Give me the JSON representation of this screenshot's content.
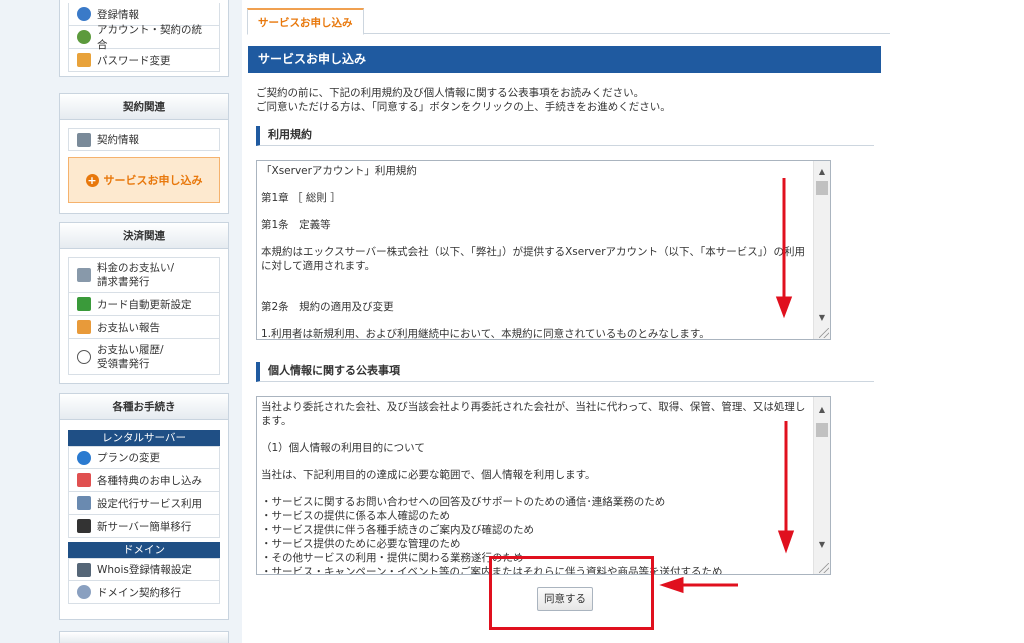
{
  "sidebar": {
    "top_items": [
      "登録情報",
      "アカウント・契約の統合",
      "パスワード変更"
    ],
    "contract": {
      "heading": "契約関連",
      "items": [
        "契約情報"
      ],
      "cta": "サービスお申し込み"
    },
    "payment": {
      "heading": "決済関連",
      "items": [
        "料金のお支払い/",
        "請求書発行",
        "カード自動更新設定",
        "お支払い報告",
        "お支払い履歴/",
        "受領書発行"
      ]
    },
    "procedures": {
      "heading": "各種お手続き",
      "rental_label": "レンタルサーバー",
      "rental_items": [
        "プランの変更",
        "各種特典のお申し込み",
        "設定代行サービス利用",
        "新サーバー簡単移行"
      ],
      "domain_label": "ドメイン",
      "domain_items": [
        "Whois登録情報設定",
        "ドメイン契約移行"
      ]
    }
  },
  "main": {
    "tab_label": "サービスお申し込み",
    "title": "サービスお申し込み",
    "intro_line1": "ご契約の前に、下記の利用規約及び個人情報に関する公表事項をお読みください。",
    "intro_line2": "ご同意いただける方は、「同意する」ボタンをクリックの上、手続きをお進めください。",
    "terms": {
      "heading": "利用規約",
      "lines": [
        "「Xserverアカウント」利用規約",
        "第1章 ［ 総則 ］",
        "第1条　定義等",
        "本規約はエックスサーバー株式会社（以下、「弊社」）が提供するXserverアカウント（以下、「本サービス」）の利用に対して適用されます。",
        "第2条　規約の適用及び変更",
        "1.利用者は新規利用、および利用継続中において、本規約に同意されているものとみなします。"
      ]
    },
    "privacy": {
      "heading": "個人情報に関する公表事項",
      "lines": [
        "当社より委託された会社、及び当該会社より再委託された会社が、当社に代わって、取得、保管、管理、又は処理します。",
        "（1）個人情報の利用目的について",
        "当社は、下記利用目的の達成に必要な範囲で、個人情報を利用します。",
        "・サービスに関するお問い合わせへの回答及びサポートのための通信･連絡業務のため",
        "・サービスの提供に係る本人確認のため",
        "・サービス提供に伴う各種手続きのご案内及び確認のため",
        "・サービス提供のために必要な管理のため",
        "・その他サービスの利用・提供に関わる業務遂行のため",
        "・サービス・キャンペーン・イベント等のご案内またはそれらに伴う資料や商品等を送付するため"
      ]
    },
    "agree_button": "同意する"
  },
  "colors": {
    "accent": "#1f5aa0",
    "orange": "#e8780c",
    "annotation_red": "#e0101e"
  },
  "icons": [
    "user-icon",
    "merge-icon",
    "lock-icon",
    "contract-icon",
    "plus-circle-icon",
    "bill-icon",
    "card-icon",
    "report-icon",
    "clock-icon",
    "change-icon",
    "gift-icon",
    "wrench-icon",
    "server-icon",
    "whois-icon",
    "domain-icon"
  ]
}
